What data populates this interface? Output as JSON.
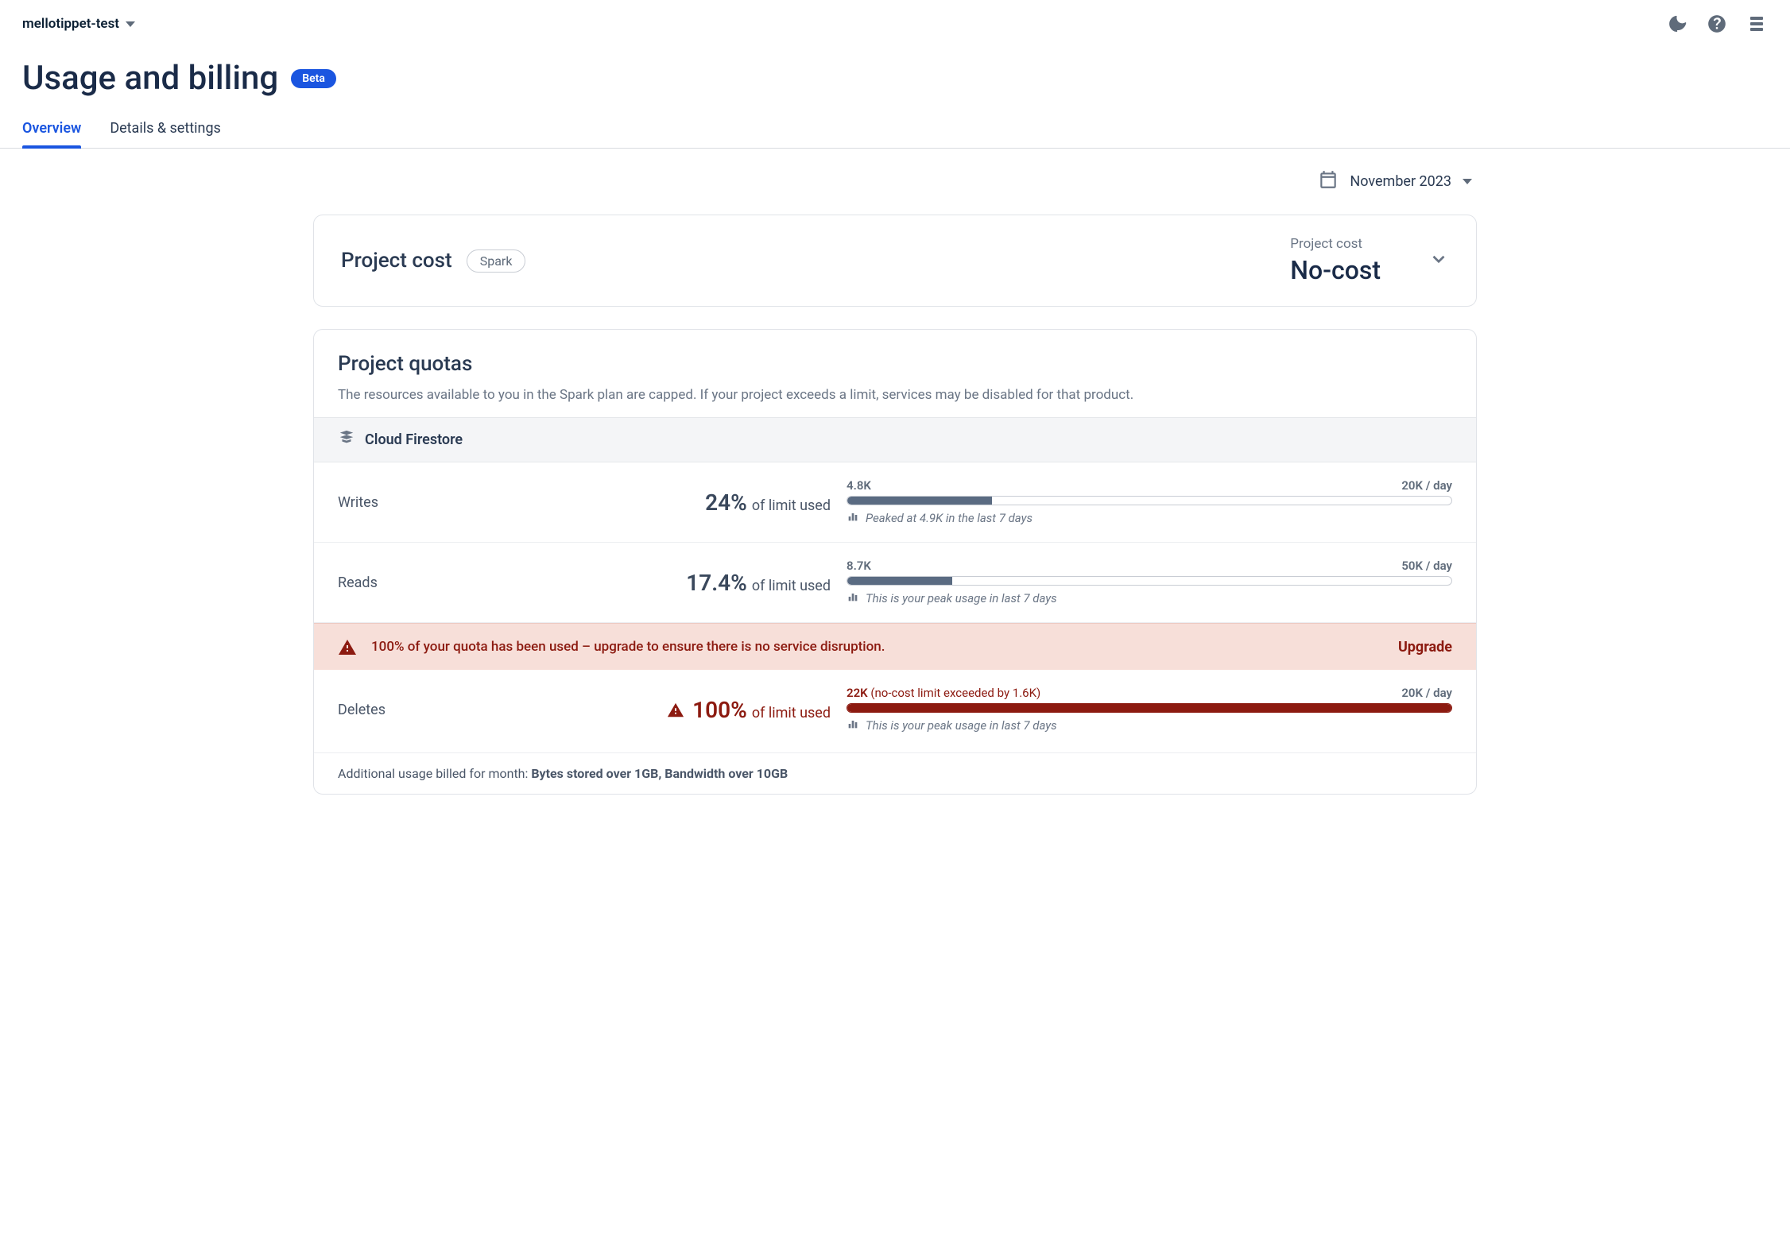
{
  "header": {
    "project_name": "mellotippet-test"
  },
  "page": {
    "title": "Usage and billing",
    "badge": "Beta"
  },
  "tabs": {
    "overview": "Overview",
    "details": "Details & settings"
  },
  "date_selector": {
    "label": "November 2023"
  },
  "cost_card": {
    "title": "Project cost",
    "plan": "Spark",
    "right_label": "Project cost",
    "value": "No-cost"
  },
  "quotas": {
    "title": "Project quotas",
    "description": "The resources available to you in the Spark plan are capped. If your project exceeds a limit, services may be disabled for that product.",
    "product_name": "Cloud Firestore",
    "rows": {
      "writes": {
        "name": "Writes",
        "pct": "24%",
        "suffix": "of limit used",
        "current": "4.8K",
        "max": "20K / day",
        "fill_pct": 24,
        "footer": "Peaked at 4.9K in the last 7 days"
      },
      "reads": {
        "name": "Reads",
        "pct": "17.4%",
        "suffix": "of limit used",
        "current": "8.7K",
        "max": "50K / day",
        "fill_pct": 17.4,
        "footer": "This is your peak usage in last 7 days"
      },
      "deletes": {
        "name": "Deletes",
        "pct": "100%",
        "suffix": "of limit used",
        "current": "22K",
        "current_extra": "(no-cost limit exceeded by 1.6K)",
        "max": "20K / day",
        "fill_pct": 100,
        "footer": "This is your peak usage in last 7 days"
      }
    },
    "warning": {
      "text": "100% of your quota has been used – upgrade to ensure there is no service disruption.",
      "action": "Upgrade"
    },
    "additional_prefix": "Additional usage billed for month: ",
    "additional_bold": "Bytes stored over 1GB, Bandwidth over 10GB"
  }
}
